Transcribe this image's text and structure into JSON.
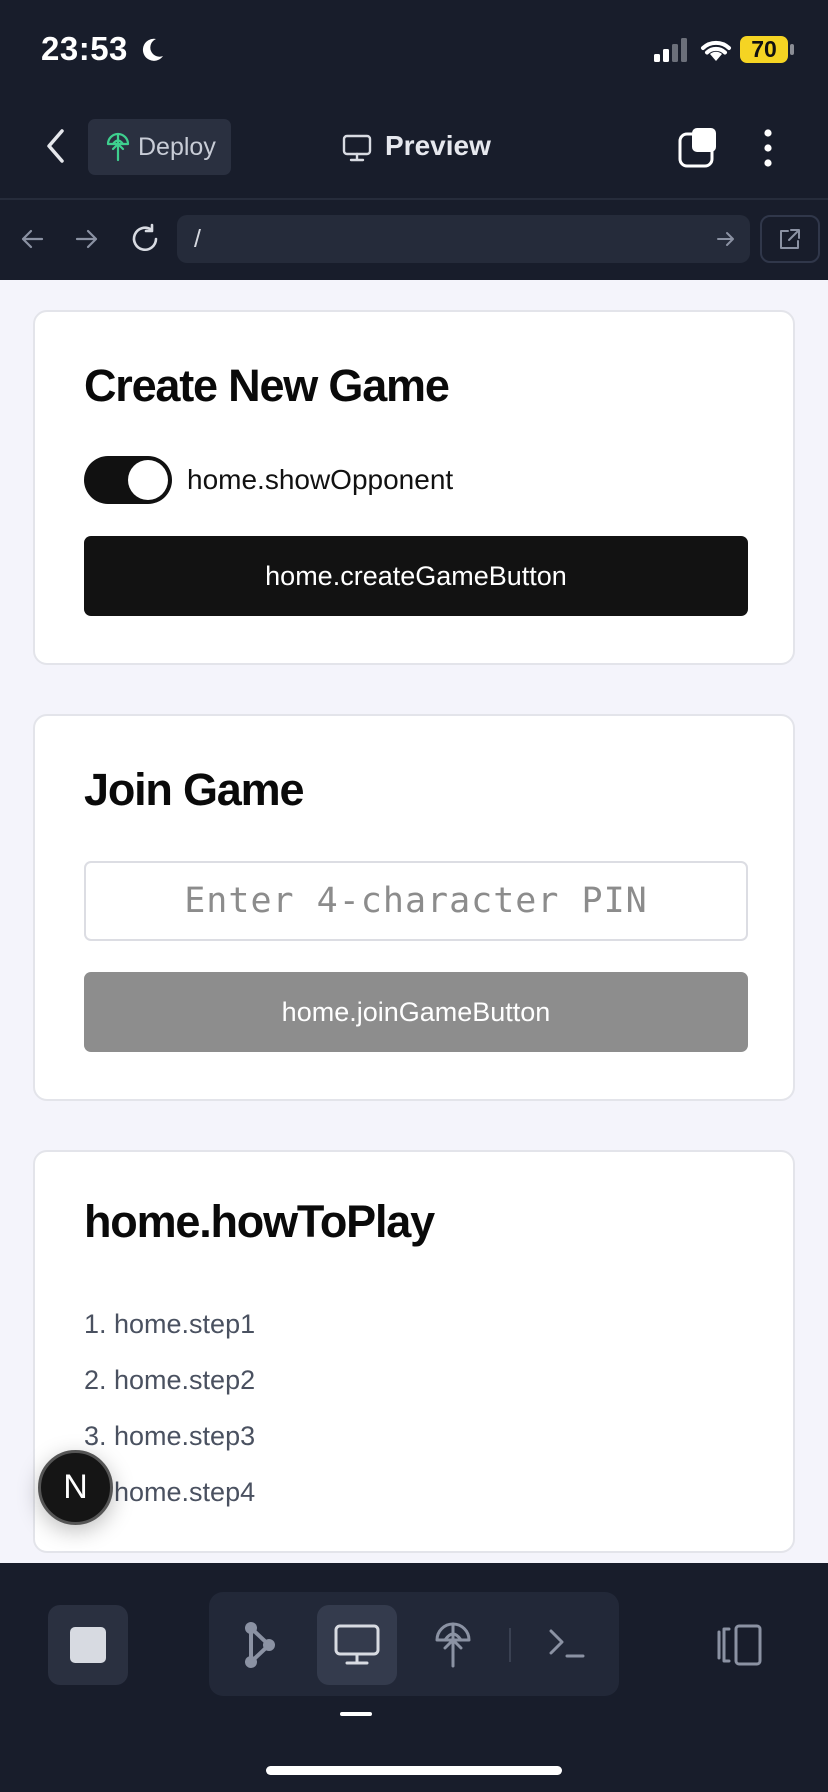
{
  "status_bar": {
    "time": "23:53",
    "battery": "70"
  },
  "header": {
    "deploy_label": "Deploy",
    "preview_label": "Preview"
  },
  "url_bar": {
    "path": "/"
  },
  "create_card": {
    "title": "Create New Game",
    "toggle_label": "home.showOpponent",
    "toggle_on": true,
    "create_button": "home.createGameButton"
  },
  "join_card": {
    "title": "Join Game",
    "pin_placeholder": "Enter 4-character PIN",
    "join_button": "home.joinGameButton"
  },
  "howto_card": {
    "title": "home.howToPlay",
    "steps": [
      "1. home.step1",
      "2. home.step2",
      "3. home.step3",
      "4. home.step4"
    ]
  },
  "badge": {
    "letter": "N"
  },
  "icons": {
    "moon": "moon-icon",
    "signal": "signal-icon",
    "wifi": "wifi-icon",
    "back": "chevron-left-icon",
    "deploy": "deploy-icon",
    "monitor": "monitor-icon",
    "tabs": "tabs-icon",
    "menu": "more-vertical-icon",
    "nav_back": "arrow-left-icon",
    "nav_forward": "arrow-right-icon",
    "reload": "reload-icon",
    "go": "arrow-right-icon",
    "external": "external-link-icon",
    "stop": "stop-icon",
    "graph": "graph-icon",
    "preview": "monitor-icon",
    "deploy_tab": "deploy-icon",
    "terminal": "terminal-icon",
    "split": "split-view-icon"
  },
  "colors": {
    "deploy_icon": "#3ecf8e",
    "battery": "#f5d423"
  }
}
